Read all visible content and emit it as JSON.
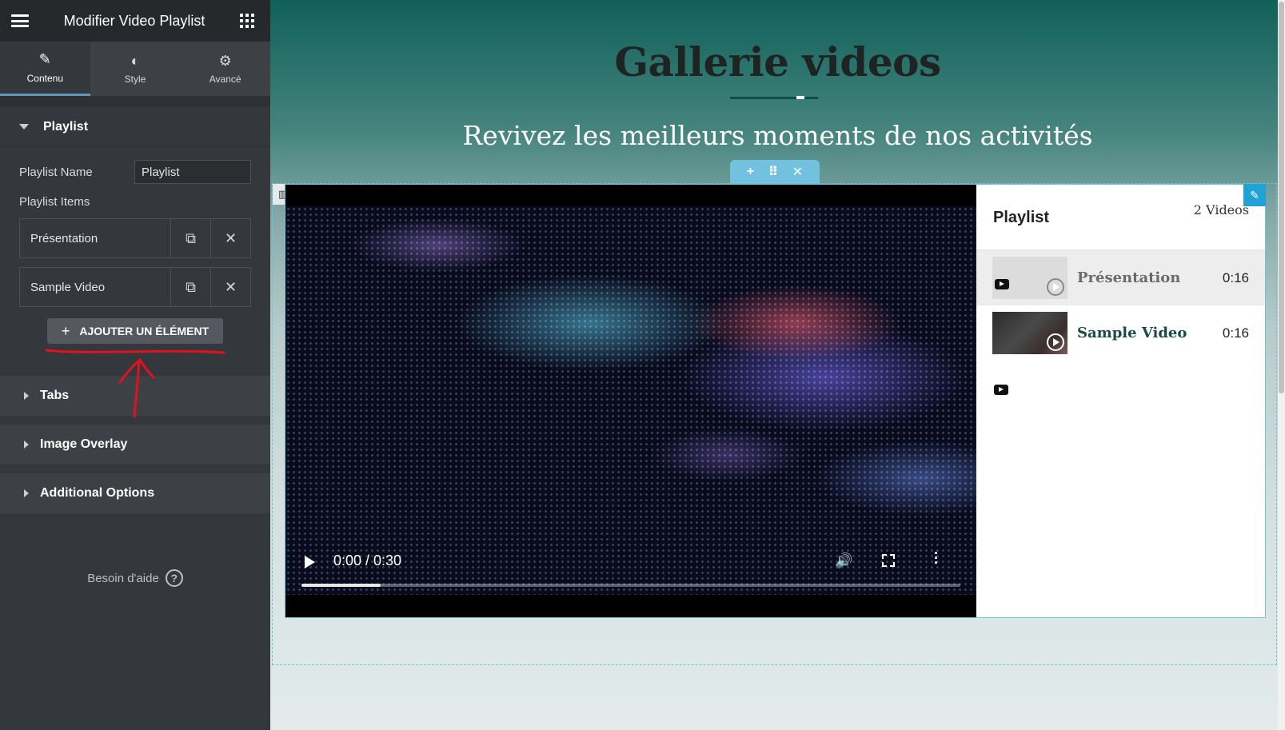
{
  "sidebar": {
    "title": "Modifier Video Playlist",
    "tabs": [
      {
        "label": "Contenu",
        "icon": "pencil-icon"
      },
      {
        "label": "Style",
        "icon": "half-circle-icon"
      },
      {
        "label": "Avancé",
        "icon": "gear-icon"
      }
    ],
    "playlist_section": {
      "heading": "Playlist",
      "name_label": "Playlist Name",
      "name_value": "Playlist",
      "items_label": "Playlist Items",
      "items": [
        "Présentation",
        "Sample Video"
      ],
      "add_button": "AJOUTER UN ÉLÉMENT"
    },
    "collapsed_sections": [
      "Tabs",
      "Image Overlay",
      "Additional Options"
    ],
    "help": "Besoin d'aide",
    "annotation_color": "#e0121e"
  },
  "main": {
    "title": "Gallerie videos",
    "subtitle": "Revivez les meilleurs moments de nos activités",
    "accent": "#1fa2d6",
    "video": {
      "time": "0:00 / 0:30",
      "progress": 0.12
    },
    "playlist": {
      "title": "Playlist",
      "count": "2 Videos",
      "items": [
        {
          "title": "Présentation",
          "duration": "0:16",
          "active": true,
          "title_color": "#6b6b6b"
        },
        {
          "title": "Sample Video",
          "duration": "0:16",
          "active": false,
          "title_color": "#1b4b47"
        }
      ]
    }
  }
}
